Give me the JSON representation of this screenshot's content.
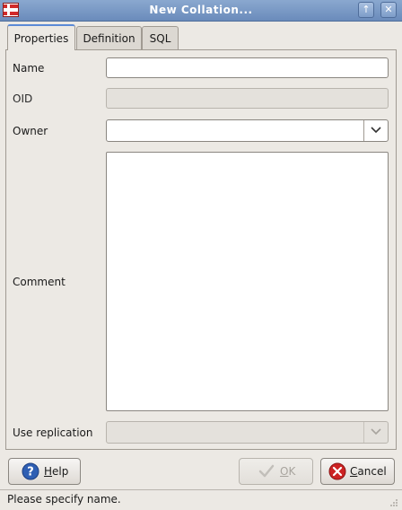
{
  "window": {
    "title": "New Collation...",
    "maximize_glyph": "↑",
    "close_glyph": "✕"
  },
  "tabs": [
    {
      "label": "Properties",
      "active": true
    },
    {
      "label": "Definition",
      "active": false
    },
    {
      "label": "SQL",
      "active": false
    }
  ],
  "form": {
    "name": {
      "label": "Name",
      "value": ""
    },
    "oid": {
      "label": "OID",
      "value": "",
      "disabled": true
    },
    "owner": {
      "label": "Owner",
      "value": ""
    },
    "comment": {
      "label": "Comment",
      "value": ""
    },
    "use_replication": {
      "label": "Use replication",
      "value": "",
      "disabled": true
    }
  },
  "buttons": {
    "help": {
      "mnemonic": "H",
      "rest": "elp",
      "icon": "help-icon"
    },
    "ok": {
      "mnemonic": "O",
      "rest": "K",
      "icon": "checkmark-icon",
      "disabled": true
    },
    "cancel": {
      "mnemonic": "C",
      "rest": "ancel",
      "icon": "cancel-icon"
    }
  },
  "status": {
    "text": "Please specify name."
  },
  "colors": {
    "titlebar": "#7a98c4",
    "accent": "#5b8ad6",
    "help_icon": "#2f5fb3",
    "cancel_icon": "#cc2222"
  }
}
